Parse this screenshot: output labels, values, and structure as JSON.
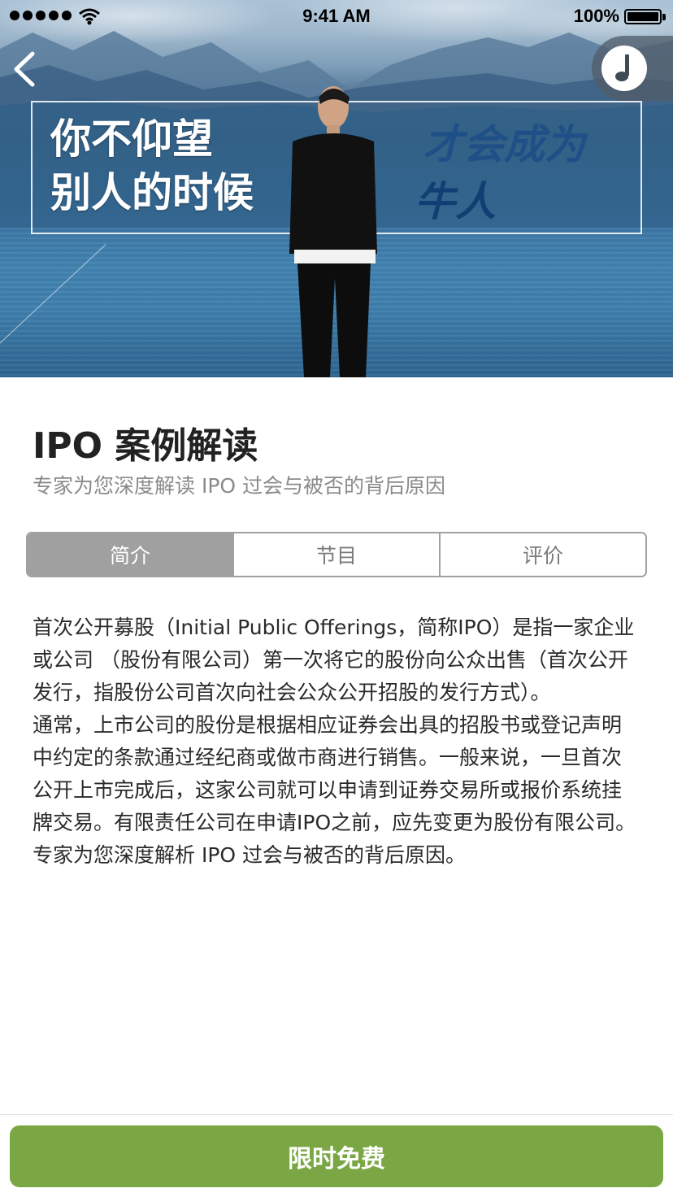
{
  "status_bar": {
    "time": "9:41 AM",
    "battery": "100%"
  },
  "header": {
    "back_icon": "chevron-left-icon",
    "music_icon": "music-note-icon"
  },
  "banner": {
    "slogan_left_line1": "你不仰望",
    "slogan_left_line2": "别人的时候",
    "slogan_right_line1": "才会成为",
    "slogan_right_line2": "牛人"
  },
  "course": {
    "title": "IPO 案例解读",
    "subtitle": "专家为您深度解读 IPO 过会与被否的背后原因"
  },
  "tabs": [
    {
      "label": "简介",
      "active": true
    },
    {
      "label": "节目",
      "active": false
    },
    {
      "label": "评价",
      "active": false
    }
  ],
  "intro": {
    "paragraph1": "首次公开募股（Initial Public Offerings，简称IPO）是指一家企业或公司 （股份有限公司）第一次将它的股份向公众出售（首次公开发行，指股份公司首次向社会公众公开招股的发行方式）。",
    "paragraph2": "通常，上市公司的股份是根据相应证券会出具的招股书或登记声明中约定的条款通过经纪商或做市商进行销售。一般来说，一旦首次公开上市完成后，这家公司就可以申请到证券交易所或报价系统挂牌交易。有限责任公司在申请IPO之前，应先变更为股份有限公司。",
    "paragraph3": "专家为您深度解析 IPO 过会与被否的背后原因。"
  },
  "footer": {
    "cta_label": "限时免费",
    "cta_color": "#7aa744"
  }
}
